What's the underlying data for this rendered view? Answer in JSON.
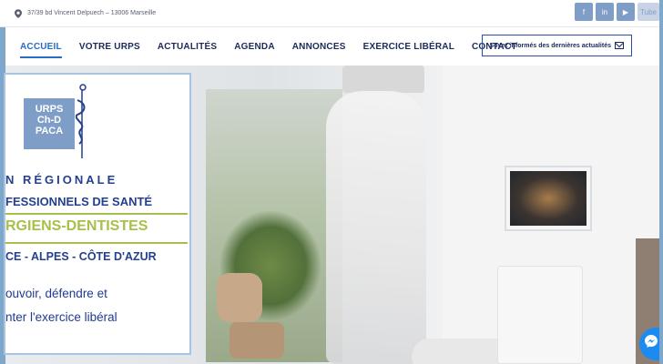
{
  "topbar": {
    "address": "37/39 bd Vincent Delpuech – 13006 Marseille",
    "social": [
      "f",
      "in",
      "▶",
      "Tube"
    ]
  },
  "nav": {
    "items": [
      "ACCUEIL",
      "VOTRE URPS",
      "ACTUALITÉS",
      "AGENDA",
      "ANNONCES",
      "EXERCICE LIBÉRAL",
      "CONTACT"
    ],
    "newsletter_label": "Soyez informés des dernières actualités"
  },
  "overlay": {
    "logo_lines": [
      "URPS",
      "Ch-D",
      "PACA"
    ],
    "line1": "N  RÉGIONALE",
    "line2": "FESSIONNELS DE SANTÉ",
    "line3": "RGIENS-DENTISTES",
    "line4": "CE - ALPES - CÔTE D'AZUR",
    "line5": "ouvoir, défendre et",
    "line6": "nter l'exercice libéral"
  },
  "colors": {
    "brand_blue": "#24408e",
    "accent_green": "#a6c14a",
    "nav_active": "#2a6bc4",
    "logo_blue": "#7e9ec8"
  },
  "icons": {
    "location": "map-pin-icon",
    "mail": "envelope-icon",
    "chat": "messenger-icon"
  }
}
